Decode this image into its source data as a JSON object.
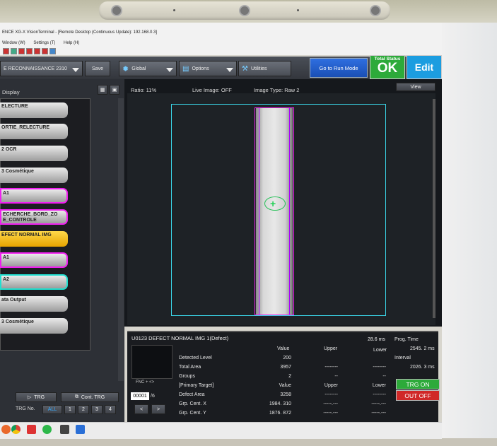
{
  "window": {
    "title": "ENCE XG-X VisionTerminal - [Remote Desktop (Continuous Update): 192.168.0.3]",
    "menu": [
      "Window (W)",
      "Settings (T)",
      "Help (H)"
    ]
  },
  "toolbar": {
    "program_name": "E RECONNAISSANCE 2310",
    "save_label": "Save",
    "global_label": "Global",
    "options_label": "Options",
    "utilities_label": "Utilities",
    "run_mode_label": "Go to Run Mode",
    "status_label": "Total Status",
    "status_value": "OK",
    "edit_label": "Edit"
  },
  "left_panel": {
    "header": "Display",
    "flow_items": [
      {
        "label": "ELECTURE",
        "style": "gray"
      },
      {
        "label": "ORTIE_RELECTURE",
        "style": "gray"
      },
      {
        "label": "2 OCR",
        "style": "gray"
      },
      {
        "label": "3 Cosmétique",
        "style": "gray"
      },
      {
        "label": "A1",
        "style": "pink"
      },
      {
        "label": "ECHERCHE_BORD_ZO\nE_CONTROLE",
        "style": "pink"
      },
      {
        "label": "EFECT NORMAL IMG",
        "style": "yellow"
      },
      {
        "label": "A1",
        "style": "pink"
      },
      {
        "label": "A2",
        "style": "teal"
      },
      {
        "label": "ata Output",
        "style": "gray"
      },
      {
        "label": "3 Cosmétique",
        "style": "gray"
      }
    ],
    "trg_label": "TRG",
    "cont_trg_label": "Cont. TRG",
    "trg_no_label": "TRG No.",
    "trg_no_options": [
      "ALL",
      "1",
      "2",
      "3",
      "4"
    ]
  },
  "viewer": {
    "ratio": "Ratio: 11%",
    "live_image": "Live Image: OFF",
    "image_type": "Image Type: Raw 2",
    "view_label": "View"
  },
  "results": {
    "title": "U0123 DEFECT NORMAL IMG 1(Defect)",
    "time": "28.6 ms",
    "fnc_label": "FNC + <>",
    "fnc_value": "00001",
    "fnc_total": "/6",
    "col_value": "Value",
    "col_upper": "Upper",
    "col_lower": "Lower",
    "rows": [
      {
        "label": "Detected Level",
        "value": "200",
        "upper": "",
        "lower": ""
      },
      {
        "label": "Total Area",
        "value": "3957",
        "upper": "--------",
        "lower": "--------"
      },
      {
        "label": "Groups",
        "value": "2",
        "upper": "--",
        "lower": "--"
      },
      {
        "label": "[Primary Target]",
        "value": "Value",
        "upper": "Upper",
        "lower": "Lower"
      },
      {
        "label": "Defect Area",
        "value": "3258",
        "upper": "--------",
        "lower": "--------"
      },
      {
        "label": "Grp. Cent. X",
        "value": "1984. 310",
        "upper": "-----.---",
        "lower": "-----.---"
      },
      {
        "label": "Grp. Cent. Y",
        "value": "1876. 872",
        "upper": "-----.---",
        "lower": "-----.---"
      }
    ],
    "prog_time_label": "Prog.  Time",
    "prog_time_value": "2545. 2 ms",
    "interval_label": "Interval",
    "interval_value": "2026. 3 ms",
    "trg_on_label": "TRG ON",
    "out_off_label": "OUT OFF"
  },
  "colors": {
    "ok_green": "#2daa3a",
    "edit_blue": "#1c9de0",
    "run_blue": "#2f6fe0",
    "roi_cyan": "#3ad4e6",
    "measure_magenta": "#f020f0",
    "out_red": "#d02828"
  }
}
